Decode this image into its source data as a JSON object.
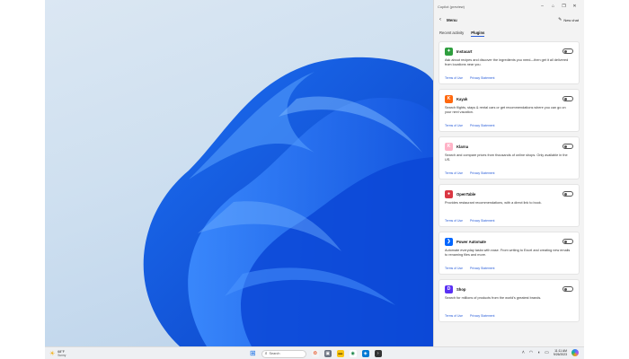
{
  "window": {
    "title": "Copilot (preview)"
  },
  "header": {
    "back_icon": "back-arrow-icon",
    "title": "Menu",
    "new_chat_label": "New chat"
  },
  "tabs": [
    {
      "label": "Recent activity",
      "active": false
    },
    {
      "label": "Plugins",
      "active": true
    }
  ],
  "plugins": [
    {
      "name": "Instacart",
      "logo_color": "#2e9e3e",
      "logo_glyph": "✦",
      "description": "Ask about recipes and discover the ingredients you need—then get it all delivered from locations near you.",
      "terms": "Terms of Use",
      "privacy": "Privacy Statement",
      "enabled": false
    },
    {
      "name": "Kayak",
      "logo_color": "#ff690f",
      "logo_glyph": "K",
      "description": "Search flights, stays & rental cars or get recommendations where you can go on your next vacation.",
      "terms": "Terms of Use",
      "privacy": "Privacy Statement",
      "enabled": false
    },
    {
      "name": "Klarna",
      "logo_color": "#ffb3c7",
      "logo_glyph": "K",
      "description": "Search and compare prices from thousands of online shops. Only available in the US.",
      "terms": "Terms of Use",
      "privacy": "Privacy Statement",
      "enabled": false
    },
    {
      "name": "OpenTable",
      "logo_color": "#da3743",
      "logo_glyph": "●",
      "description": "Provides restaurant recommendations, with a direct link to book.",
      "terms": "Terms of Use",
      "privacy": "Privacy Statement",
      "enabled": false
    },
    {
      "name": "Power Automate",
      "logo_color": "#0066ff",
      "logo_glyph": "❯",
      "description": "Automate everyday tasks with ease. From writing to Excel and creating new emails to renaming files and more.",
      "terms": "Terms of Use",
      "privacy": "Privacy Statement",
      "enabled": false
    },
    {
      "name": "Shop",
      "logo_color": "#5a31f4",
      "logo_glyph": "D",
      "description": "Search for millions of products from the world's greatest brands.",
      "terms": "Terms of Use",
      "privacy": "Privacy Statement",
      "enabled": false
    }
  ],
  "taskbar": {
    "weather_temp": "68°F",
    "weather_cond": "Sunny",
    "search_placeholder": "Search",
    "time": "11:11 AM",
    "date": "9/26/2023"
  }
}
